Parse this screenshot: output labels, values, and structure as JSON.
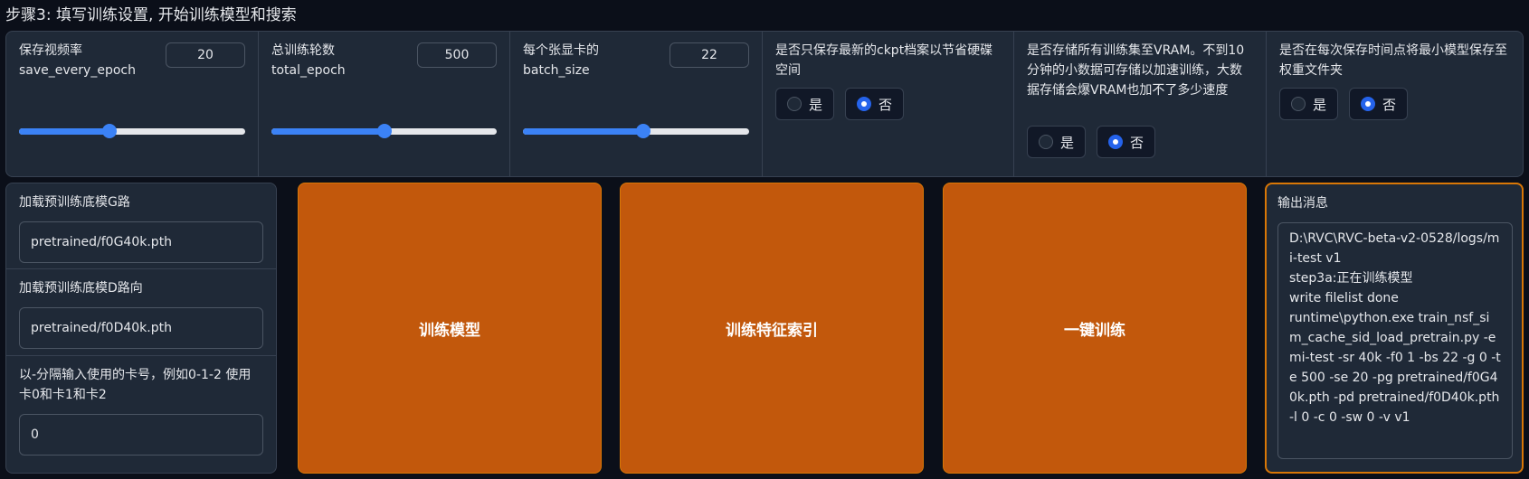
{
  "step_title": "步骤3: 填写训练设置, 开始训练模型和搜索",
  "save_every_epoch": {
    "label": "保存视频率\nsave_every_epoch",
    "value": "20",
    "slider_fraction": 0.4
  },
  "total_epoch": {
    "label": "总训练轮数\ntotal_epoch",
    "value": "500",
    "slider_fraction": 0.5
  },
  "batch_size": {
    "label": "每个张显卡的\nbatch_size",
    "value": "22",
    "slider_fraction": 0.53
  },
  "save_latest_ckpt": {
    "label": "是否只保存最新的ckpt档案以节省硬碟空间",
    "options": [
      "是",
      "否"
    ],
    "selected": "否"
  },
  "cache_gpu": {
    "label": "是否存储所有训练集至VRAM。不到10分钟的小数据可存储以加速训练，大数据存储会爆VRAM也加不了多少速度",
    "options": [
      "是",
      "否"
    ],
    "selected": "否"
  },
  "save_small_model": {
    "label": "是否在每次保存时间点将最小模型保存至权重文件夹",
    "options": [
      "是",
      "否"
    ],
    "selected": "否"
  },
  "pretrained_g": {
    "label": "加载预训练底模G路",
    "value": "pretrained/f0G40k.pth"
  },
  "pretrained_d": {
    "label": "加载预训练底模D路向",
    "value": "pretrained/f0D40k.pth"
  },
  "gpus": {
    "label": "以-分隔输入使用的卡号，例如0-1-2 使用卡0和卡1和卡2",
    "value": "0"
  },
  "buttons": {
    "train_model": "训练模型",
    "train_index": "训练特征索引",
    "one_click": "一键训练"
  },
  "output": {
    "label": "输出消息",
    "text": "D:\\RVC\\RVC-beta-v2-0528/logs/mi-test v1\nstep3a:正在训练模型\nwrite filelist done\nruntime\\python.exe train_nsf_sim_cache_sid_load_pretrain.py -e mi-test -sr 40k -f0 1 -bs 22 -g 0 -te 500 -se 20 -pg pretrained/f0G40k.pth -pd pretrained/f0D40k.pth -l 0 -c 0 -sw 0 -v v1"
  },
  "colors": {
    "accent_blue": "#3b82f6",
    "button_orange": "#c2580c",
    "panel_bg": "#1f2937",
    "page_bg": "#0b0f19"
  }
}
